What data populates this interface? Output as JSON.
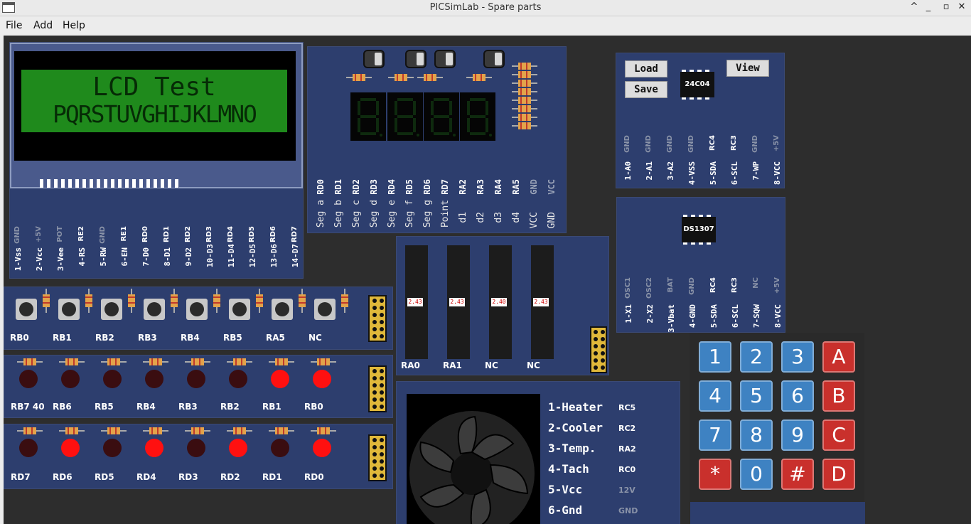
{
  "window": {
    "title": "PICSimLab - Spare parts",
    "minimize": "^",
    "restore": "_",
    "maximize": "▫",
    "close": "✕"
  },
  "menu": [
    "File",
    "Add",
    "Help"
  ],
  "lcd": {
    "line1": "LCD Test",
    "line2": "PQRSTUVGHIJKLMNO",
    "pins": [
      [
        "GND",
        "1-Vss"
      ],
      [
        "+5V",
        "2-Vcc"
      ],
      [
        "POT",
        "3-Vee"
      ],
      [
        "RE2",
        "4-RS"
      ],
      [
        "GND",
        "5-RW"
      ],
      [
        "RE1",
        "6-EN"
      ],
      [
        "RD0",
        "7-D0"
      ],
      [
        "RD1",
        "8-D1"
      ],
      [
        "RD2",
        "9-D2"
      ],
      [
        "RD3",
        "10-D3"
      ],
      [
        "RD4",
        "11-D4"
      ],
      [
        "RD5",
        "12-D5"
      ],
      [
        "RD6",
        "13-D6"
      ],
      [
        "RD7",
        "14-D7"
      ]
    ]
  },
  "seven_seg": {
    "pins": [
      [
        "RD0",
        "Seg a"
      ],
      [
        "RD1",
        "Seg b"
      ],
      [
        "RD2",
        "Seg c"
      ],
      [
        "RD3",
        "Seg d"
      ],
      [
        "RD4",
        "Seg e"
      ],
      [
        "RD5",
        "Seg f"
      ],
      [
        "RD6",
        "Seg g"
      ],
      [
        "RD7",
        "Point"
      ],
      [
        "RA2",
        "d1"
      ],
      [
        "RA3",
        "d2"
      ],
      [
        "RA4",
        "d3"
      ],
      [
        "RA5",
        "d4"
      ],
      [
        "GND",
        "VCC"
      ],
      [
        "VCC",
        "GND"
      ]
    ]
  },
  "eeprom": {
    "chip": "24C04",
    "load": "Load",
    "save": "Save",
    "view": "View",
    "pins": [
      [
        "GND",
        "1-A0"
      ],
      [
        "GND",
        "2-A1"
      ],
      [
        "GND",
        "3-A2"
      ],
      [
        "GND",
        "4-VSS"
      ],
      [
        "RC4",
        "5-SDA"
      ],
      [
        "RC3",
        "6-SCL"
      ],
      [
        "GND",
        "7-WP"
      ],
      [
        "+5V",
        "8-VCC"
      ]
    ]
  },
  "rtc": {
    "chip": "DS1307",
    "pins": [
      [
        "OSC1",
        "1-X1"
      ],
      [
        "OSC2",
        "2-X2"
      ],
      [
        "BAT",
        "3-Vbat"
      ],
      [
        "GND",
        "4-GND"
      ],
      [
        "RC4",
        "5-SDA"
      ],
      [
        "RC3",
        "6-SCL"
      ],
      [
        "NC",
        "7-SQW"
      ],
      [
        "+5V",
        "8-VCC"
      ]
    ]
  },
  "buttons": [
    "RB0",
    "RB1",
    "RB2",
    "RB3",
    "RB4",
    "RB5",
    "RA5",
    "NC"
  ],
  "leds1": {
    "labels": [
      "RB7 40",
      "RB6",
      "RB5",
      "RB4",
      "RB3",
      "RB2",
      "RB1",
      "RB0"
    ],
    "state": [
      0,
      0,
      0,
      0,
      0,
      0,
      1,
      1
    ]
  },
  "leds2": {
    "labels": [
      "RD7",
      "RD6",
      "RD5",
      "RD4",
      "RD3",
      "RD2",
      "RD1",
      "RD0"
    ],
    "state": [
      0,
      1,
      0,
      1,
      0,
      1,
      0,
      1
    ]
  },
  "pots": {
    "labels": [
      "RA0",
      "RA1",
      "NC",
      "NC"
    ],
    "values": [
      "2.43",
      "2.43",
      "2.40",
      "2.43"
    ]
  },
  "fan": {
    "pins": [
      [
        "1-Heater",
        "RC5"
      ],
      [
        "2-Cooler",
        "RC2"
      ],
      [
        "3-Temp.",
        "RA2"
      ],
      [
        "4-Tach",
        "RC0"
      ],
      [
        "5-Vcc",
        "12V"
      ],
      [
        "6-Gnd",
        "GND"
      ]
    ]
  },
  "keypad": [
    [
      "1",
      "2",
      "3",
      "A"
    ],
    [
      "4",
      "5",
      "6",
      "B"
    ],
    [
      "7",
      "8",
      "9",
      "C"
    ],
    [
      "*",
      "0",
      "#",
      "D"
    ]
  ],
  "colors": {
    "board": "#2d3e6e",
    "lcd_green": "#1f8a1c",
    "led_on": "#ff1010"
  }
}
